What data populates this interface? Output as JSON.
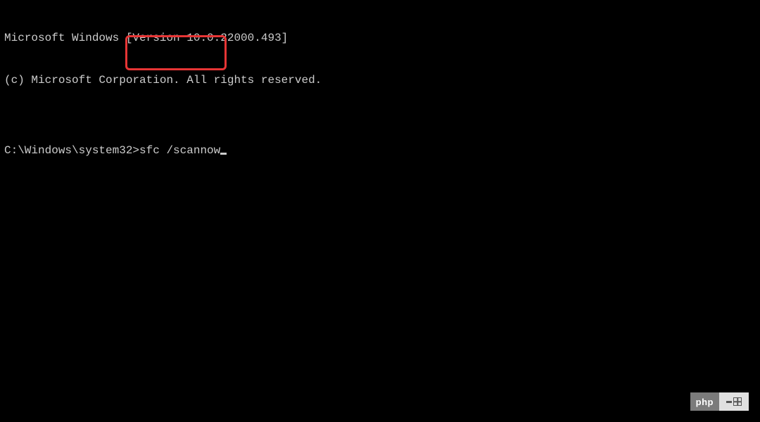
{
  "terminal": {
    "header_line1": "Microsoft Windows [Version 10.0.22000.493]",
    "header_line2": "(c) Microsoft Corporation. All rights reserved.",
    "blank": "",
    "prompt": "C:\\Windows\\system32>",
    "command": "sfc /scannow"
  },
  "watermark": {
    "label": "php"
  }
}
